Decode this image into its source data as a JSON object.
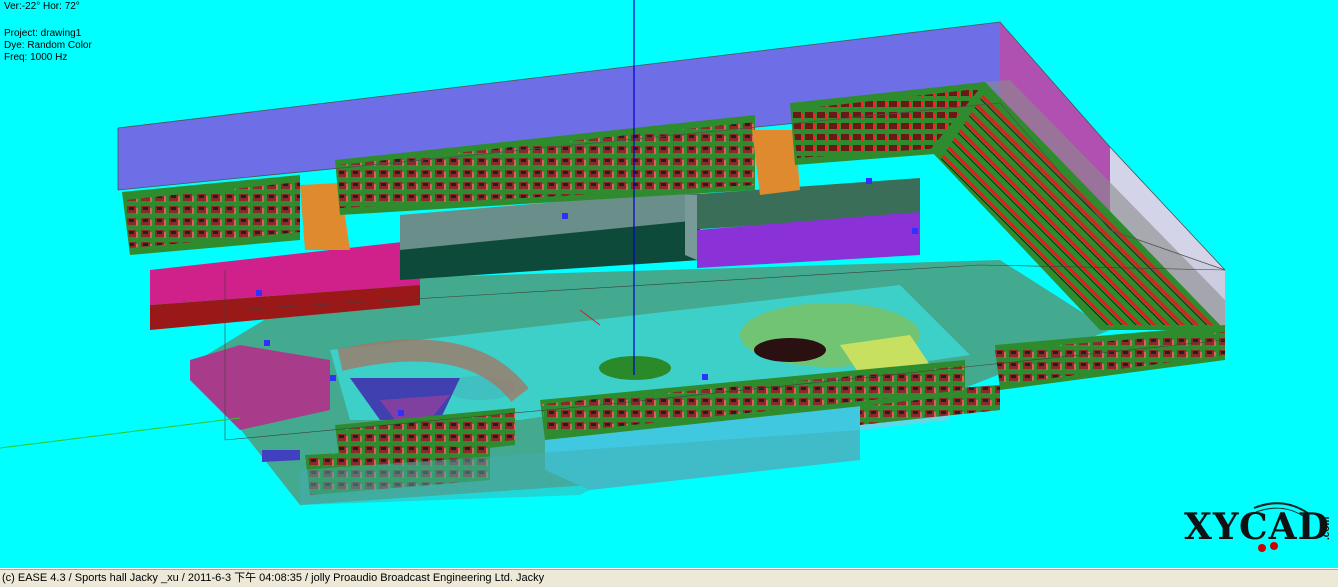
{
  "overlay": {
    "view_angle": "Ver:-22°   Hor: 72°",
    "project": "Project: drawing1",
    "dye": "Dye: Random Color",
    "freq": "Freq: 1000 Hz"
  },
  "status_bar": {
    "text": "(c) EASE 4.3  / Sports hall Jacky _xu / 2011-6-3 下午 04:08:35 / jolly Proaudio Broadcast Engineering Ltd. Jacky"
  },
  "logo": {
    "text": "XYCAD",
    "suffix": ".com"
  },
  "colors": {
    "background": "#00FFFF",
    "ceiling": "#6E6EE6",
    "seat_green": "#1E8C1E",
    "seat_red": "#E01E1E",
    "axis_blue": "#0000CC",
    "axis_green": "#22CC22"
  }
}
